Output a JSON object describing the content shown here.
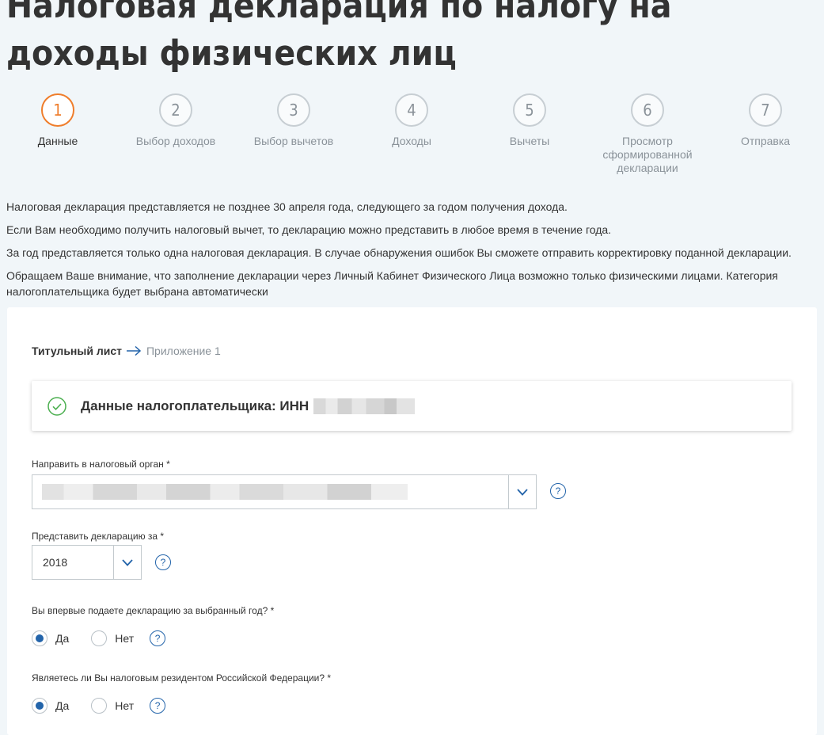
{
  "page": {
    "title": "Налоговая декларация по налогу на доходы физических лиц"
  },
  "stepper": {
    "steps": [
      {
        "number": "1",
        "label": "Данные",
        "state": "active"
      },
      {
        "number": "2",
        "label": "Выбор доходов",
        "state": "inactive"
      },
      {
        "number": "3",
        "label": "Выбор вычетов",
        "state": "inactive"
      },
      {
        "number": "4",
        "label": "Доходы",
        "state": "inactive"
      },
      {
        "number": "5",
        "label": "Вычеты",
        "state": "inactive"
      },
      {
        "number": "6",
        "label": "Просмотр сформированной декларации",
        "state": "inactive"
      },
      {
        "number": "7",
        "label": "Отправка",
        "state": "inactive"
      }
    ]
  },
  "info": {
    "paragraphs": [
      "Налоговая декларация представляется не позднее 30 апреля года, следующего за годом получения дохода.",
      "Если Вам необходимо получить налоговый вычет, то декларацию можно представить в любое время в течение года.",
      "За год представляется только одна налоговая декларация. В случае обнаружения ошибок Вы сможете отправить корректировку поданной декларации.",
      "Обращаем Ваше внимание, что заполнение декларации через Личный Кабинет Физического Лица возможно только физическими лицами. Категория налогоплательщика будет выбрана автоматически"
    ]
  },
  "form": {
    "breadcrumb": {
      "current": "Титульный лист",
      "next": "Приложение 1"
    },
    "taxpayer": {
      "label": "Данные налогоплательщика: ИНН"
    },
    "tax_authority": {
      "label": "Направить в налоговый орган *",
      "help": "?"
    },
    "declaration_year": {
      "label": "Представить декларацию за *",
      "value": "2018",
      "help": "?"
    },
    "first_time": {
      "label": "Вы впервые подаете декларацию за выбранный год? *",
      "options": [
        "Да",
        "Нет"
      ],
      "selected": "Да",
      "help": "?"
    },
    "resident": {
      "label": "Являетесь ли Вы налоговым резидентом Российской Федерации? *",
      "options": [
        "Да",
        "Нет"
      ],
      "selected": "Да",
      "help": "?"
    }
  },
  "colors": {
    "accent": "#ef7d2b",
    "primary": "#2364aa",
    "success": "#4caf50",
    "background": "#f1f6f9"
  }
}
